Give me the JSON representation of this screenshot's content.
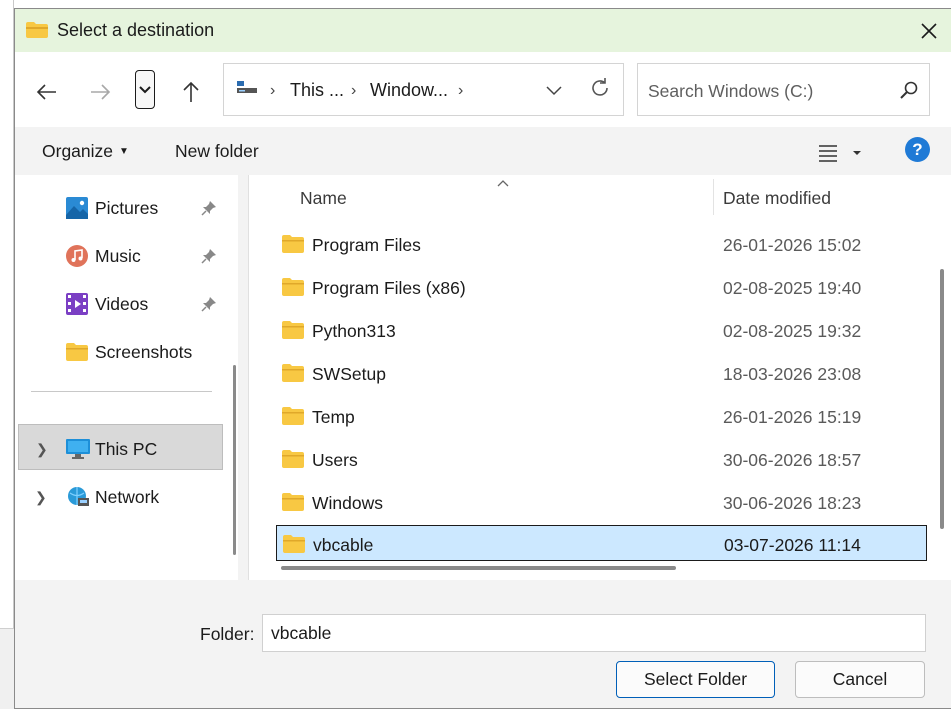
{
  "dialog": {
    "title": "Select a destination"
  },
  "nav": {
    "back_icon": "arrow-left-icon",
    "forward_icon": "arrow-right-icon",
    "recent_icon": "chevron-down-icon",
    "up_icon": "arrow-up-icon"
  },
  "address": {
    "segments": [
      "This ...",
      "Window..."
    ],
    "refresh_icon": "refresh-icon"
  },
  "search": {
    "placeholder": "Search Windows (C:)"
  },
  "toolbar": {
    "organize_label": "Organize",
    "new_folder_label": "New folder"
  },
  "sidebar": {
    "items": [
      {
        "label": "Pictures",
        "icon": "pictures-icon",
        "pinned": true
      },
      {
        "label": "Music",
        "icon": "music-icon",
        "pinned": true
      },
      {
        "label": "Videos",
        "icon": "videos-icon",
        "pinned": true
      },
      {
        "label": "Screenshots",
        "icon": "folder-icon",
        "pinned": false
      }
    ],
    "locations": [
      {
        "label": "This PC",
        "icon": "computer-icon",
        "selected": true
      },
      {
        "label": "Network",
        "icon": "network-icon",
        "selected": false
      }
    ]
  },
  "files": {
    "columns": {
      "name": "Name",
      "date": "Date modified"
    },
    "rows": [
      {
        "name": "Program Files",
        "date": "26-01-2026 15:02"
      },
      {
        "name": "Program Files (x86)",
        "date": "02-08-2025 19:40"
      },
      {
        "name": "Python313",
        "date": "02-08-2025 19:32"
      },
      {
        "name": "SWSetup",
        "date": "18-03-2026 23:08"
      },
      {
        "name": "Temp",
        "date": "26-01-2026 15:19"
      },
      {
        "name": "Users",
        "date": "30-06-2026 18:57"
      },
      {
        "name": "Windows",
        "date": "30-06-2026 18:23"
      },
      {
        "name": "vbcable",
        "date": "03-07-2026 11:14"
      }
    ],
    "selected_index": 7
  },
  "footer": {
    "folder_label": "Folder:",
    "folder_value": "vbcable",
    "select_button": "Select Folder",
    "cancel_button": "Cancel"
  },
  "colors": {
    "title_bg": "#e6f4dd",
    "selection_bg": "#cce8ff",
    "accent": "#005fb8",
    "help_blue": "#1f7ad6",
    "folder_yellow": "#f8c843"
  }
}
